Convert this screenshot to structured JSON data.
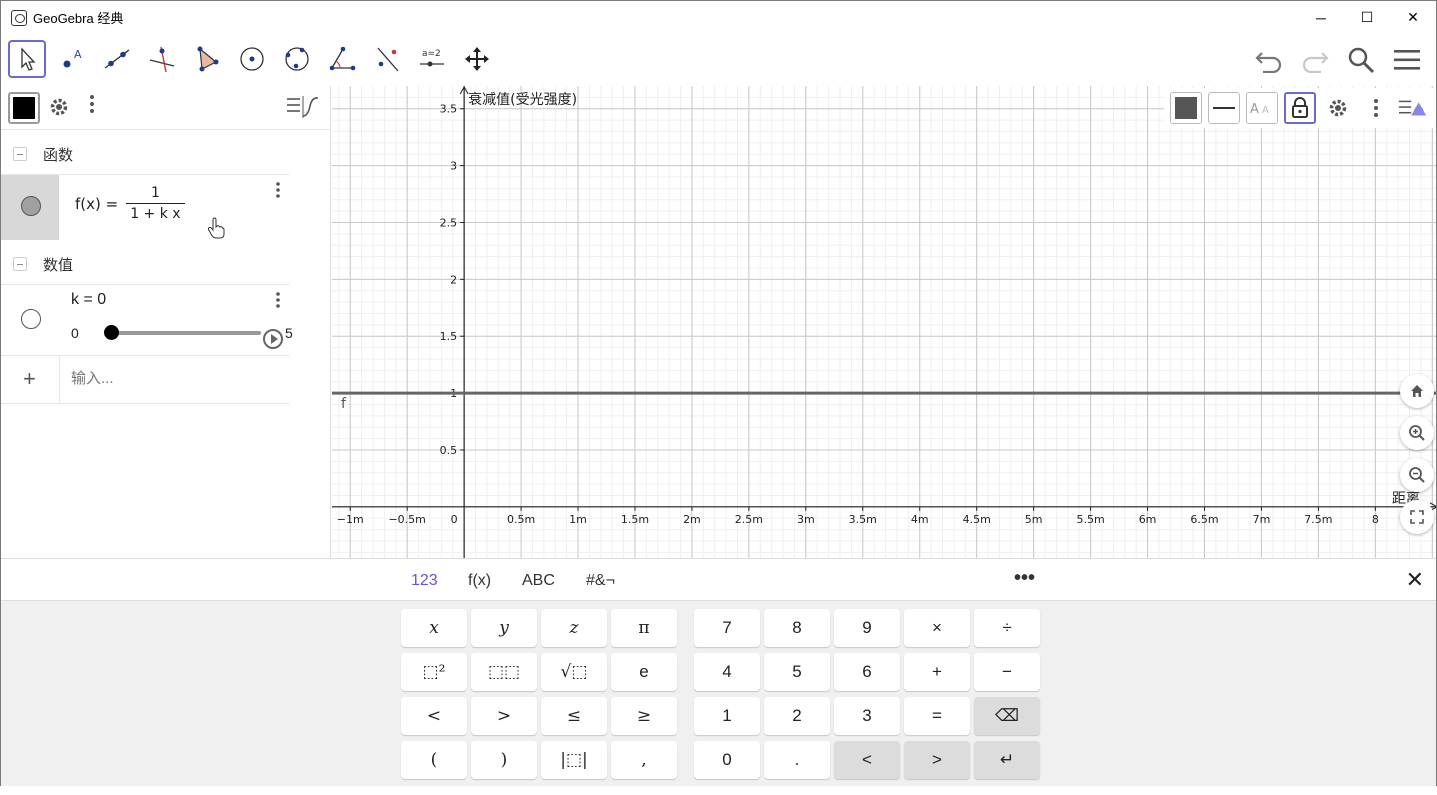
{
  "window": {
    "title": "GeoGebra 经典",
    "minimize": "─",
    "maximize": "☐",
    "close": "✕"
  },
  "toolbar": {
    "tools": [
      {
        "name": "move-tool",
        "active": true
      },
      {
        "name": "point-tool",
        "active": false
      },
      {
        "name": "line-tool",
        "active": false
      },
      {
        "name": "perpendicular-line-tool",
        "active": false
      },
      {
        "name": "polygon-tool",
        "active": false
      },
      {
        "name": "circle-tool",
        "active": false
      },
      {
        "name": "conic-tool",
        "active": false
      },
      {
        "name": "angle-tool",
        "active": false
      },
      {
        "name": "reflect-tool",
        "active": false
      },
      {
        "name": "slider-tool",
        "active": false,
        "label": "a=2"
      },
      {
        "name": "move-graphics-tool",
        "active": false
      }
    ]
  },
  "algebra": {
    "groups": [
      {
        "title": "函数"
      },
      {
        "title": "数值"
      }
    ],
    "function_item": {
      "lhs": "f(x) =",
      "numerator": "1",
      "denominator": "1 + k x"
    },
    "slider_item": {
      "label": "k = 0",
      "min": "0",
      "max": "5",
      "value": 0
    },
    "input_placeholder": "输入..."
  },
  "graphics": {
    "y_axis_label": "衰减值(受光强度)",
    "x_axis_label": "距离",
    "function_label": "f",
    "x_ticks": [
      "−1m",
      "−0.5m",
      "0",
      "0.5m",
      "1m",
      "1.5m",
      "2m",
      "2.5m",
      "3m",
      "3.5m",
      "4m",
      "4.5m",
      "5m",
      "5.5m",
      "6m",
      "6.5m",
      "7m",
      "7.5m",
      "8"
    ],
    "y_ticks": [
      "0.5",
      "1",
      "1.5",
      "2",
      "2.5",
      "3",
      "3.5"
    ],
    "x_range": [
      -1.16,
      8.55
    ],
    "y_range": [
      -0.45,
      3.7
    ],
    "f_value": 1
  },
  "keyboard": {
    "tabs": [
      "123",
      "f(x)",
      "ABC",
      "#&¬"
    ],
    "more": "•••",
    "close": "✕",
    "left_keys": [
      [
        "x",
        "y",
        "z",
        "π"
      ],
      [
        "⬚²",
        "⬚⬚",
        "√⬚",
        "e"
      ],
      [
        "<",
        ">",
        "≤",
        "≥"
      ],
      [
        "(",
        ")",
        "|⬚|",
        ","
      ]
    ],
    "right_keys": [
      [
        "7",
        "8",
        "9",
        "×",
        "÷"
      ],
      [
        "4",
        "5",
        "6",
        "+",
        "−"
      ],
      [
        "1",
        "2",
        "3",
        "=",
        "⌫"
      ],
      [
        "0",
        ".",
        "<",
        ">",
        "↵"
      ]
    ]
  }
}
